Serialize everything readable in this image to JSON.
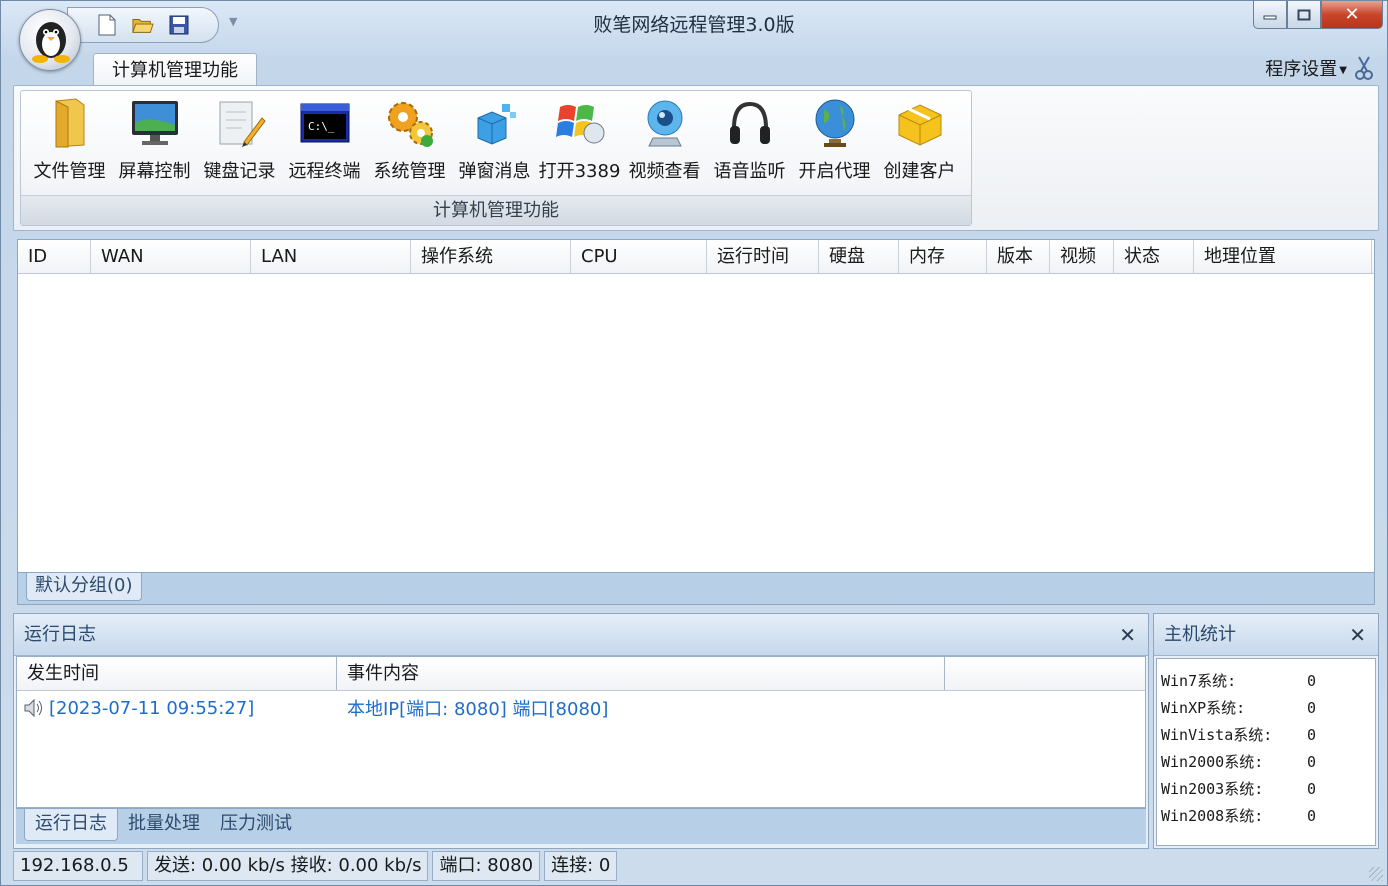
{
  "window": {
    "title": "败笔网络远程管理3.0版"
  },
  "ribbon": {
    "tab": "计算机管理功能",
    "settings": "程序设置",
    "group_label": "计算机管理功能",
    "tools": [
      {
        "label": "文件管理",
        "icon": "folder-icon"
      },
      {
        "label": "屏幕控制",
        "icon": "monitor-icon"
      },
      {
        "label": "键盘记录",
        "icon": "notepad-pencil-icon"
      },
      {
        "label": "远程终端",
        "icon": "terminal-icon"
      },
      {
        "label": "系统管理",
        "icon": "gears-icon"
      },
      {
        "label": "弹窗消息",
        "icon": "message-cubes-icon"
      },
      {
        "label": "打开3389",
        "icon": "windows-remote-icon"
      },
      {
        "label": "视频查看",
        "icon": "webcam-icon"
      },
      {
        "label": "语音监听",
        "icon": "headphones-icon"
      },
      {
        "label": "开启代理",
        "icon": "globe-icon"
      },
      {
        "label": "创建客户",
        "icon": "package-icon"
      }
    ]
  },
  "list": {
    "columns": [
      "ID",
      "WAN",
      "LAN",
      "操作系统",
      "CPU",
      "运行时间",
      "硬盘",
      "内存",
      "版本",
      "视频",
      "状态",
      "地理位置"
    ],
    "group_tab": "默认分组(0)"
  },
  "log": {
    "title": "运行日志",
    "columns": [
      "发生时间",
      "事件内容",
      ""
    ],
    "rows": [
      {
        "time": "[2023-07-11 09:55:27]",
        "event": "本地IP[端口: 8080] 端口[8080]"
      }
    ],
    "tabs": [
      "运行日志",
      "批量处理",
      "压力测试"
    ]
  },
  "stats": {
    "title": "主机统计",
    "rows": [
      {
        "label": "Win7系统:",
        "value": "0"
      },
      {
        "label": "WinXP系统:",
        "value": "0"
      },
      {
        "label": "WinVista系统:",
        "value": "0"
      },
      {
        "label": "Win2000系统:",
        "value": "0"
      },
      {
        "label": "Win2003系统:",
        "value": "0"
      },
      {
        "label": "Win2008系统:",
        "value": "0"
      }
    ]
  },
  "status": {
    "ip": "192.168.0.5",
    "traffic": "发送: 0.00 kb/s 接收: 0.00 kb/s",
    "port": "端口: 8080",
    "connections": "连接: 0"
  },
  "colors": {
    "accent": "#1e6dcc",
    "close_button": "#c9452a",
    "panel_bg": "#b7cfe7"
  }
}
